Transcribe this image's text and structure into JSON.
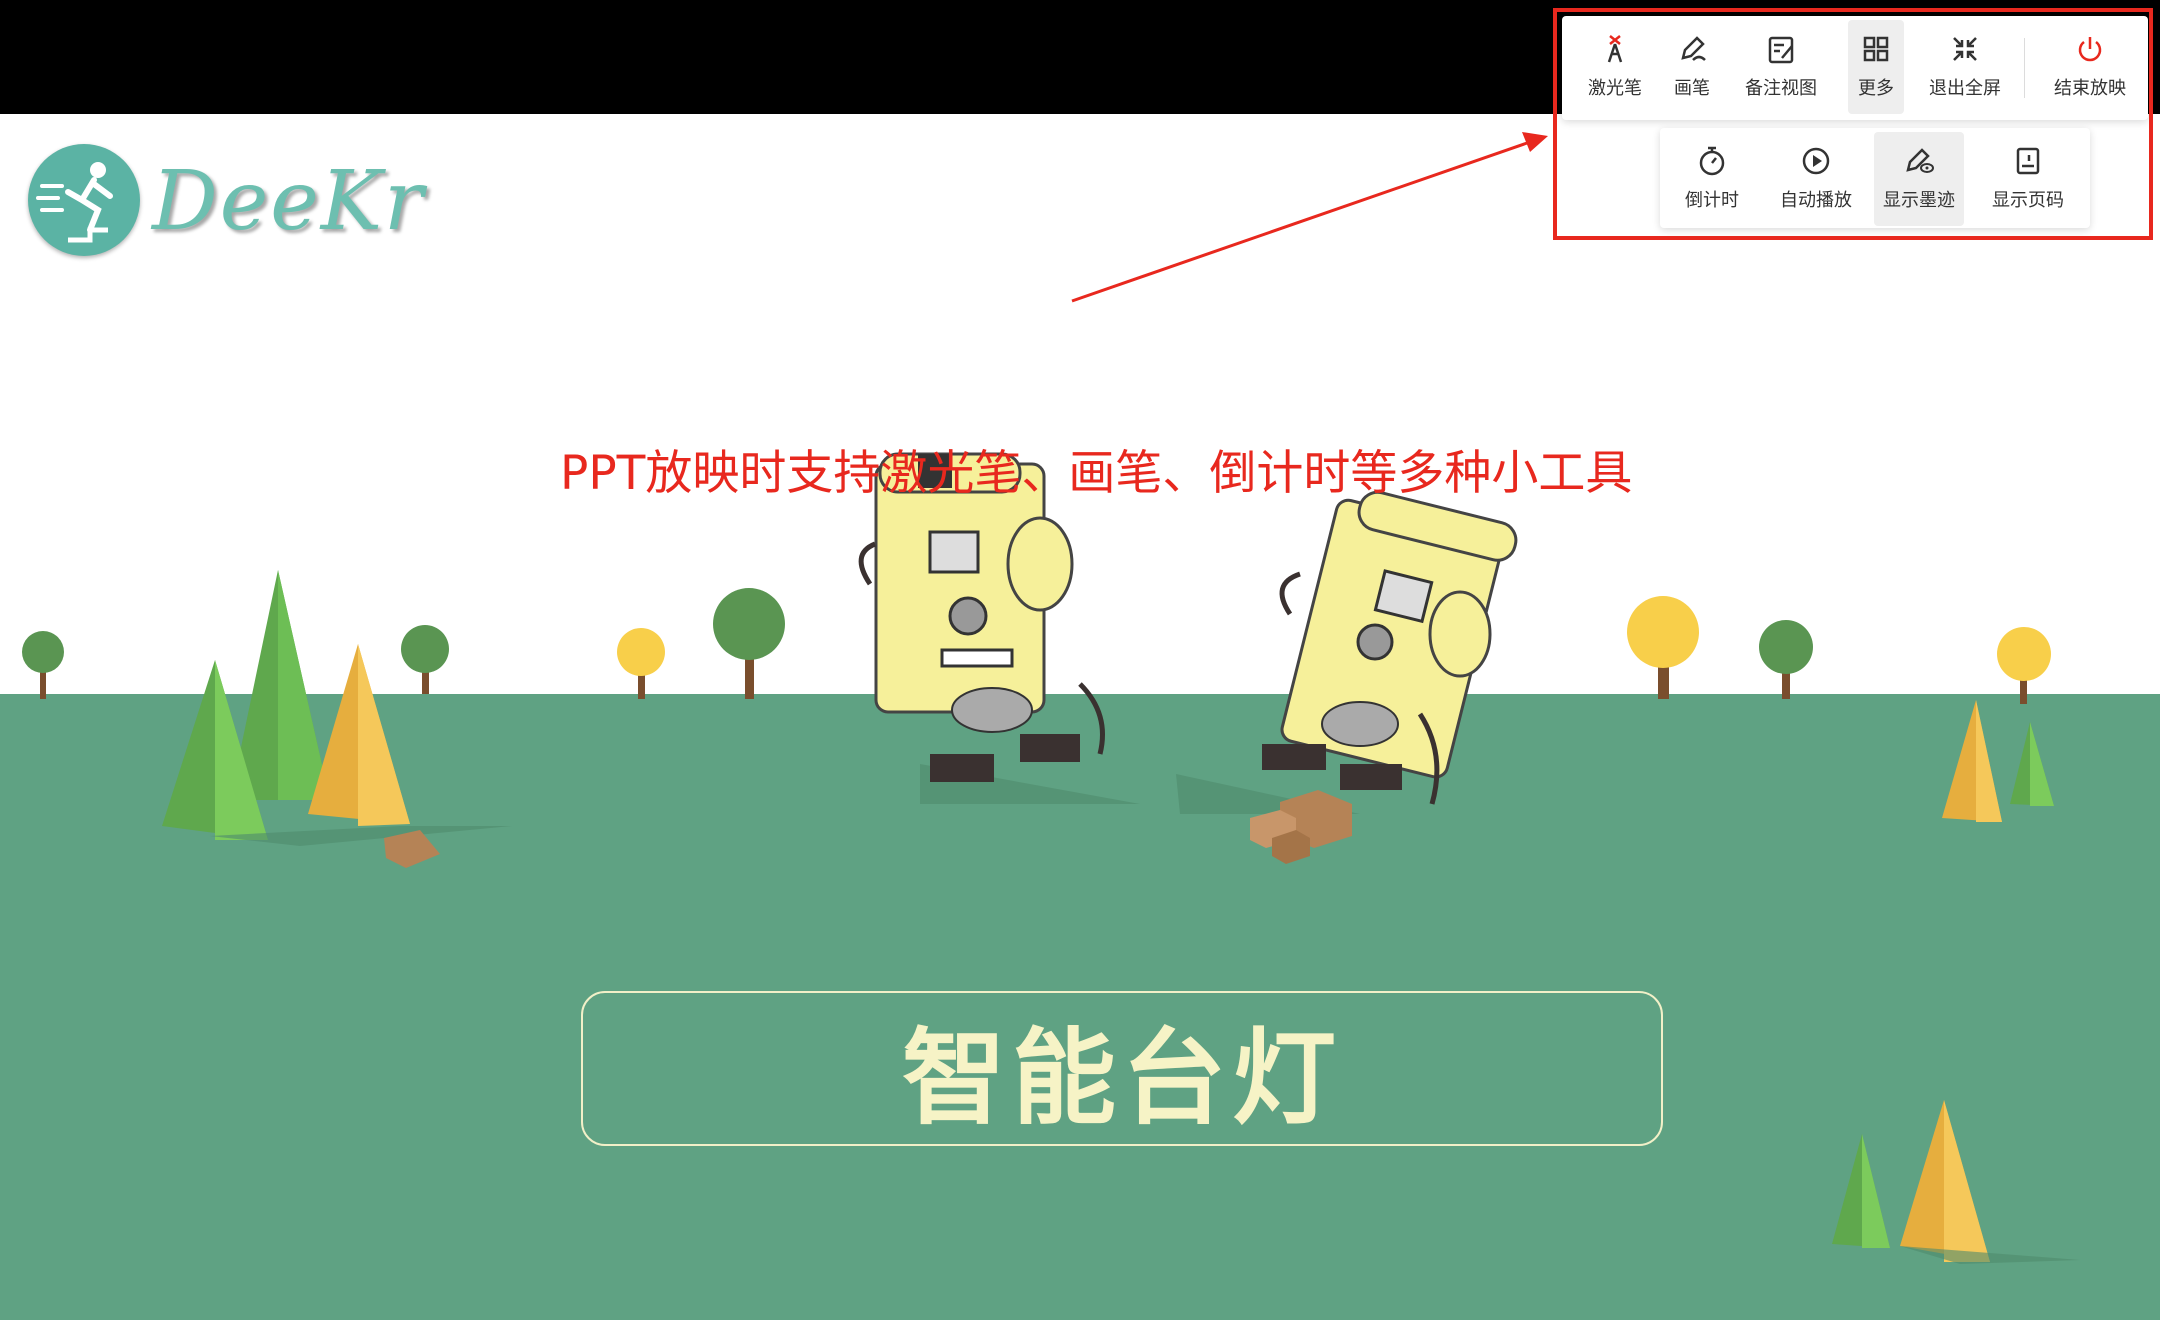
{
  "toolbar": {
    "main_buttons": [
      {
        "label": "激光笔",
        "icon": "laser-pointer-icon"
      },
      {
        "label": "画笔",
        "icon": "pen-icon"
      },
      {
        "label": "备注视图",
        "icon": "notes-view-icon"
      },
      {
        "label": "更多",
        "icon": "grid-more-icon"
      },
      {
        "label": "退出全屏",
        "icon": "exit-fullscreen-icon"
      },
      {
        "label": "结束放映",
        "icon": "power-icon"
      }
    ],
    "more_buttons": [
      {
        "label": "倒计时",
        "icon": "stopwatch-icon"
      },
      {
        "label": "自动播放",
        "icon": "play-circle-icon"
      },
      {
        "label": "显示墨迹",
        "icon": "show-ink-icon"
      },
      {
        "label": "显示页码",
        "icon": "page-number-icon"
      }
    ],
    "active": [
      "更多",
      "显示墨迹"
    ],
    "end_color": "#e8281e"
  },
  "logo": {
    "text": "DeeKr"
  },
  "annotation": {
    "text": "PPT放映时支持激光笔、画笔、倒计时等多种小工具",
    "color": "#e8281e"
  },
  "slide": {
    "title": "智能台灯",
    "ground_color": "#5fa283",
    "title_color": "#f6f3c6"
  }
}
